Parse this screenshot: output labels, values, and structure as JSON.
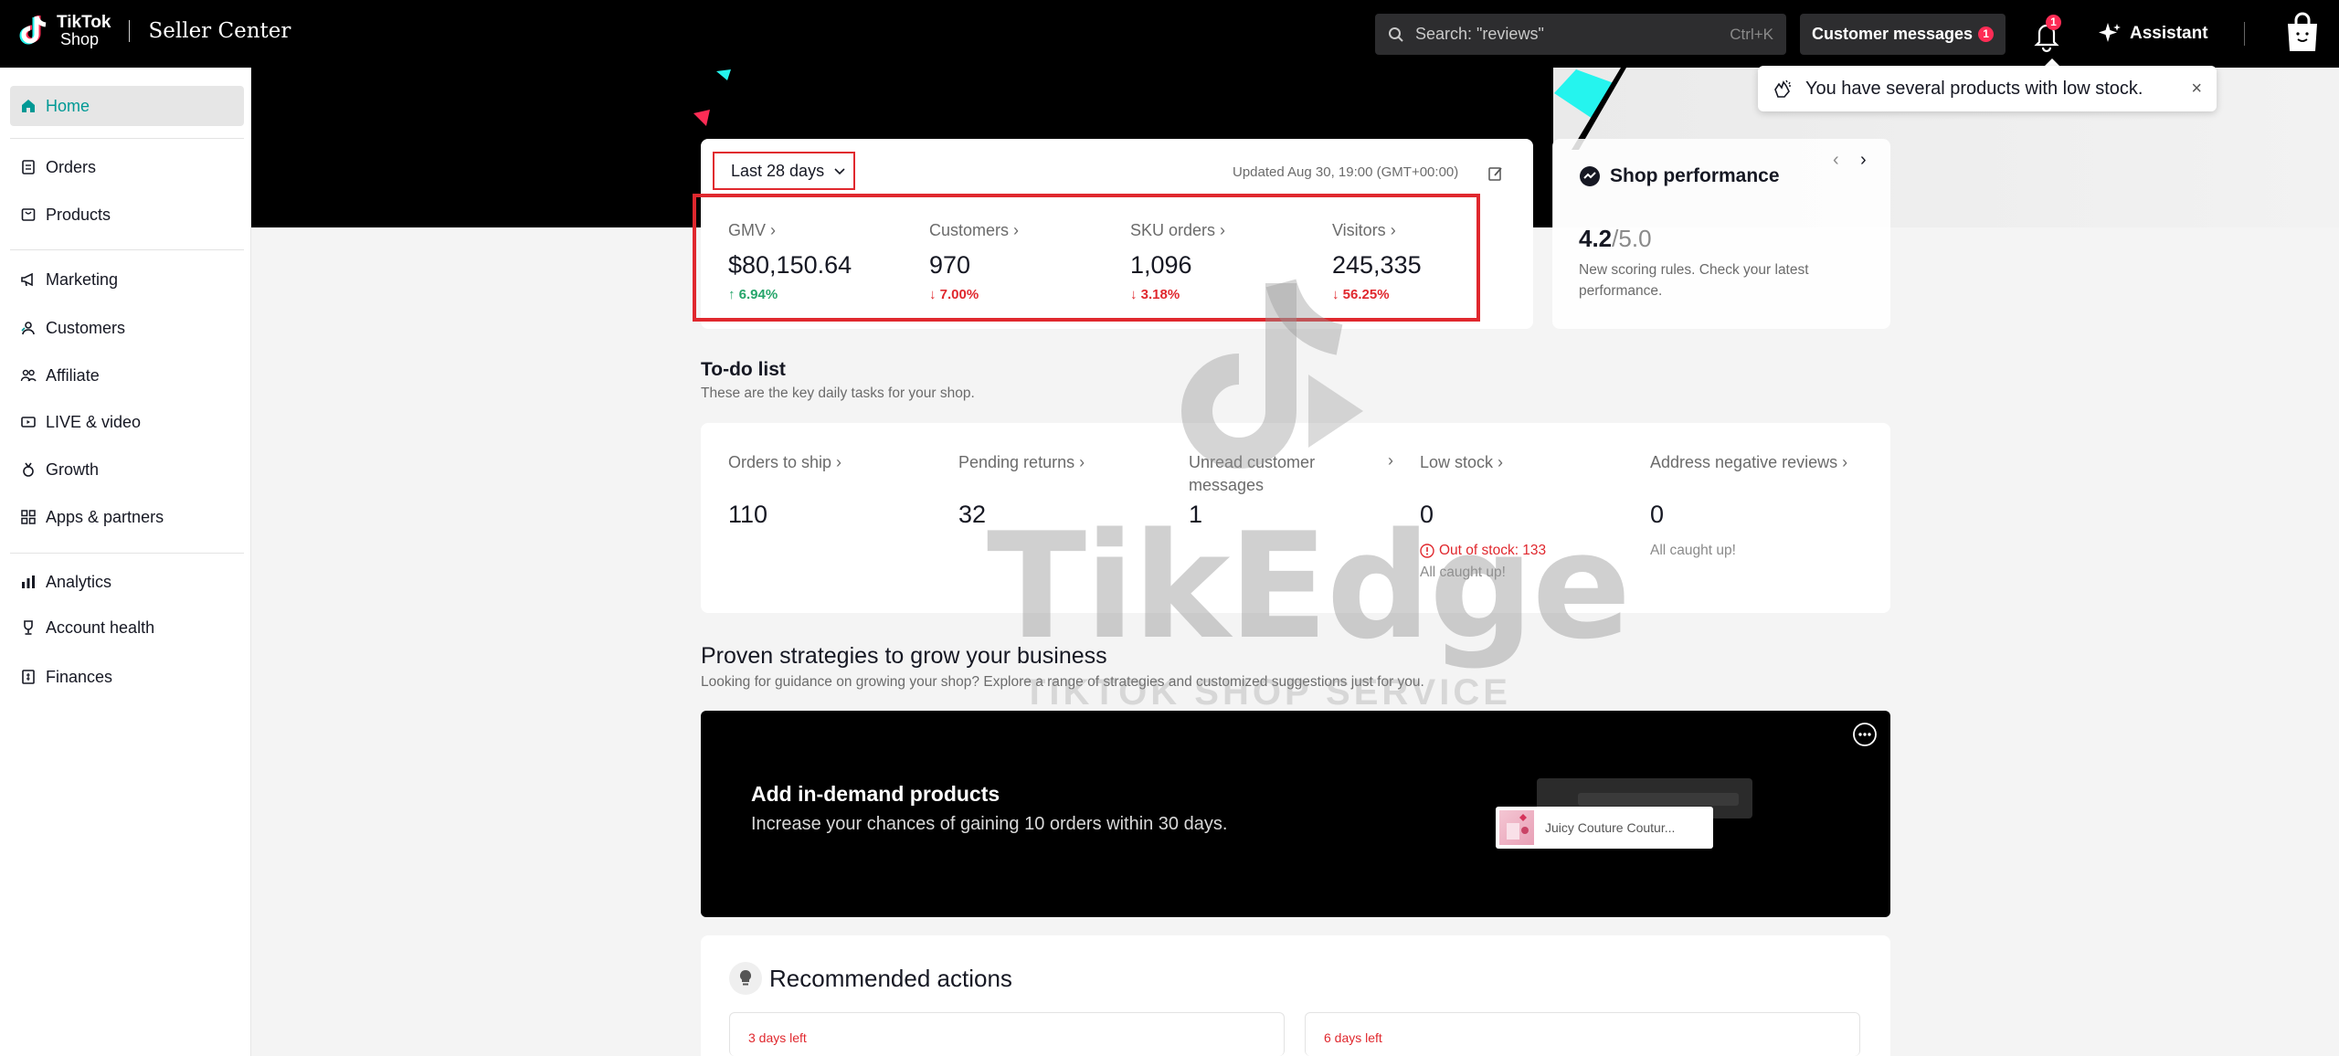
{
  "app": {
    "brand_line1": "TikTok",
    "brand_line2": "Shop",
    "title": "Seller Center"
  },
  "topbar": {
    "search_placeholder": "Search: \"reviews\"",
    "search_shortcut": "Ctrl+K",
    "customer_messages_label": "Customer messages",
    "customer_messages_count": "1",
    "notifications_count": "1",
    "assistant_label": "Assistant"
  },
  "toast": {
    "message": "You have several products with low stock.",
    "close": "×"
  },
  "sidebar": {
    "items": [
      {
        "label": "Home",
        "icon": "home-icon",
        "active": true
      },
      {
        "label": "Orders",
        "icon": "orders-icon"
      },
      {
        "label": "Products",
        "icon": "products-icon"
      },
      {
        "label": "Marketing",
        "icon": "megaphone-icon"
      },
      {
        "label": "Customers",
        "icon": "customers-icon"
      },
      {
        "label": "Affiliate",
        "icon": "affiliate-icon"
      },
      {
        "label": "LIVE & video",
        "icon": "live-video-icon"
      },
      {
        "label": "Growth",
        "icon": "growth-icon"
      },
      {
        "label": "Apps & partners",
        "icon": "apps-icon"
      },
      {
        "label": "Analytics",
        "icon": "analytics-icon"
      },
      {
        "label": "Account health",
        "icon": "trophy-icon"
      },
      {
        "label": "Finances",
        "icon": "finances-icon"
      }
    ]
  },
  "overview": {
    "period": "Last 28 days",
    "updated": "Updated Aug 30, 19:00 (GMT+00:00)",
    "metrics": [
      {
        "label": "GMV",
        "value": "$80,150.64",
        "change": "6.94%",
        "direction": "up"
      },
      {
        "label": "Customers",
        "value": "970",
        "change": "7.00%",
        "direction": "down"
      },
      {
        "label": "SKU orders",
        "value": "1,096",
        "change": "3.18%",
        "direction": "down"
      },
      {
        "label": "Visitors",
        "value": "245,335",
        "change": "56.25%",
        "direction": "down"
      }
    ]
  },
  "shop_performance": {
    "title": "Shop performance",
    "score": "4.2",
    "score_max": "/5.0",
    "description": "New scoring rules. Check your latest performance."
  },
  "todo": {
    "title": "To-do list",
    "subtitle": "These are the key daily tasks for your shop.",
    "items": [
      {
        "label": "Orders to ship",
        "value": "110"
      },
      {
        "label": "Pending returns",
        "value": "32"
      },
      {
        "label": "Unread customer messages",
        "value": "1"
      },
      {
        "label": "Low stock",
        "value": "0",
        "warning": "Out of stock: 133",
        "note": "All caught up!"
      },
      {
        "label": "Address negative reviews",
        "value": "0",
        "note": "All caught up!"
      }
    ]
  },
  "strategies": {
    "title": "Proven strategies to grow your business",
    "subtitle": "Looking for guidance on growing your shop? Explore a range of strategies and customized suggestions just for you.",
    "banner_title": "Add in-demand products",
    "banner_subtitle": "Increase your chances of gaining 10 orders within 30 days.",
    "product_name": "Juicy Couture Coutur..."
  },
  "recommended": {
    "title": "Recommended actions",
    "cards": [
      {
        "deadline": "3 days left"
      },
      {
        "deadline": "6 days left"
      }
    ]
  },
  "watermark": {
    "word": "TikEdge",
    "sub": "TIKTOK SHOP SERVICE"
  },
  "colors": {
    "accent": "#009995",
    "alert_red": "#e0282e",
    "positive_green": "#25a56a",
    "badge_pink": "#fe2c55"
  }
}
